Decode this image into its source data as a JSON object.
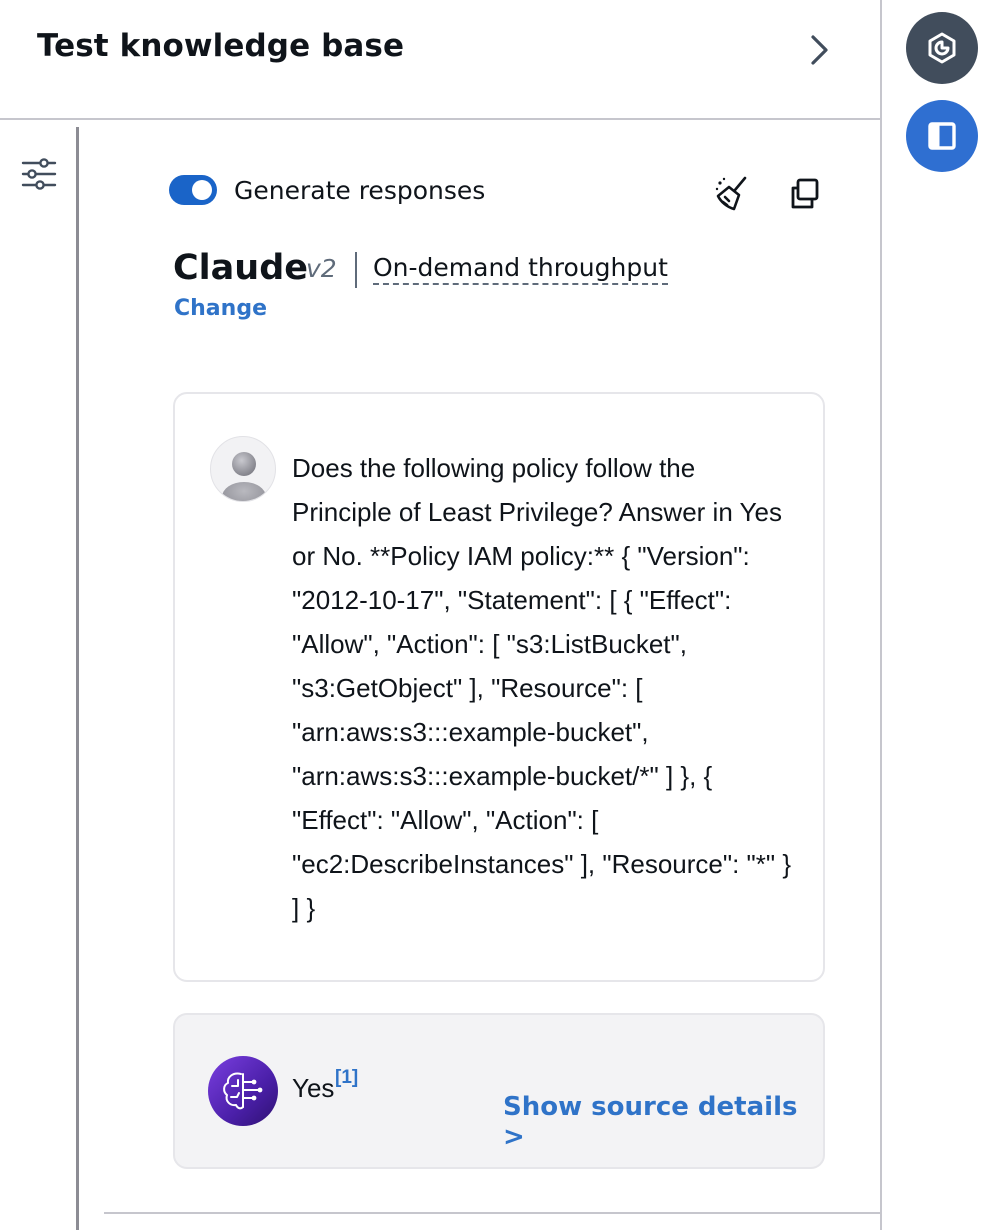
{
  "panel": {
    "title": "Test knowledge base"
  },
  "controls": {
    "generate_responses_label": "Generate responses",
    "generate_responses_on": true
  },
  "model": {
    "name": "Claude",
    "version": "v2",
    "throughput": "On-demand throughput",
    "change_label": "Change"
  },
  "conversation": {
    "user_message": "Does the following policy follow the Principle of Least Privilege? Answer in Yes or No. **Policy IAM policy:** { \"Version\": \"2012-10-17\", \"Statement\": [ { \"Effect\": \"Allow\", \"Action\": [ \"s3:ListBucket\", \"s3:GetObject\" ], \"Resource\": [ \"arn:aws:s3:::example-bucket\", \"arn:aws:s3:::example-bucket/*\" ] }, { \"Effect\": \"Allow\", \"Action\": [ \"ec2:DescribeInstances\" ], \"Resource\": \"*\" } ] }",
    "response_text": "Yes",
    "response_citation": "[1]",
    "show_source_label": "Show source details >"
  },
  "icons": {
    "chevron": "chevron-right-icon",
    "settings": "sliders-icon",
    "clear": "broom-icon",
    "copy": "copy-icon",
    "ai_assist": "ai-assistant-icon",
    "side_panel": "side-panel-icon"
  },
  "colors": {
    "accent": "#2f73c8",
    "toggle": "#1a64c8",
    "side_dark": "#414d5c",
    "side_blue": "#2f6fd1"
  }
}
